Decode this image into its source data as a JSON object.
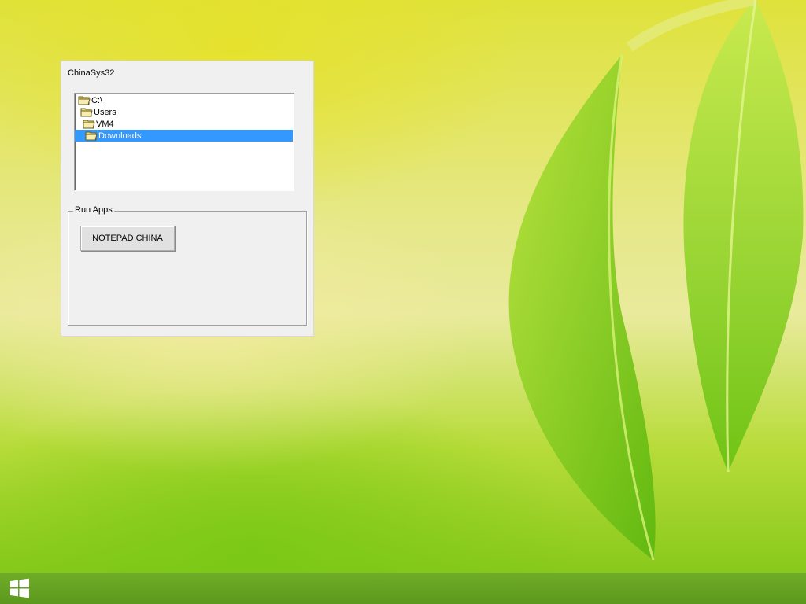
{
  "window": {
    "title": "ChinaSys32"
  },
  "tree": {
    "items": [
      {
        "label": "C:\\",
        "icon": "folder-open-icon"
      },
      {
        "label": "Users",
        "icon": "folder-open-icon"
      },
      {
        "label": "VM4",
        "icon": "folder-open-icon"
      },
      {
        "label": "Downloads",
        "icon": "folder-open-icon",
        "selected": true
      }
    ]
  },
  "group": {
    "label": "Run Apps",
    "button_label": "NOTEPAD CHINA"
  },
  "taskbar": {
    "start_icon": "windows-logo-icon"
  },
  "colors": {
    "selection": "#3399ff",
    "taskbar": "#6eaa28"
  }
}
